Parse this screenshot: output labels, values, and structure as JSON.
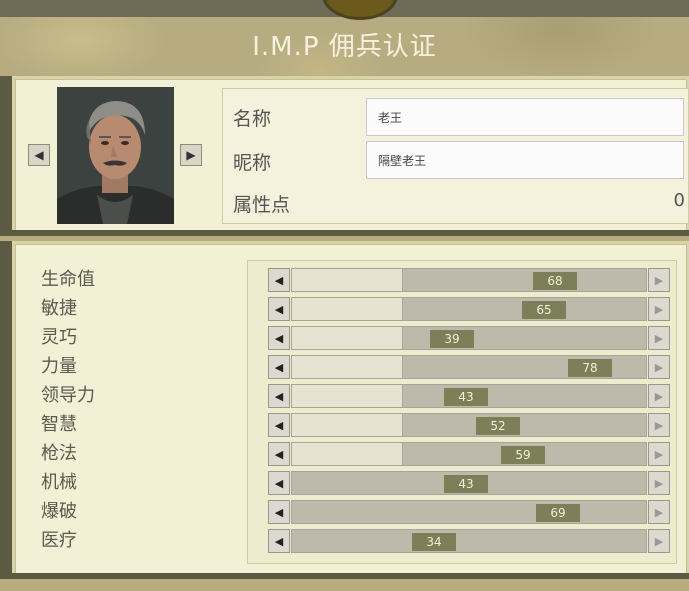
{
  "header": {
    "title": "I.M.P 佣兵认证"
  },
  "profile": {
    "name_label": "名称",
    "name_value": "老王",
    "nickname_label": "昵称",
    "nickname_value": "隔壁老王",
    "attr_points_label": "属性点",
    "attr_points_value": "0",
    "prev_arrow": "◀",
    "next_arrow": "▶"
  },
  "stats": [
    {
      "label": "生命值",
      "value": "68",
      "fraction": 0.68,
      "base_fraction": 0.31
    },
    {
      "label": "敏捷",
      "value": "65",
      "fraction": 0.65,
      "base_fraction": 0.31
    },
    {
      "label": "灵巧",
      "value": "39",
      "fraction": 0.39,
      "base_fraction": 0.31
    },
    {
      "label": "力量",
      "value": "78",
      "fraction": 0.78,
      "base_fraction": 0.31
    },
    {
      "label": "领导力",
      "value": "43",
      "fraction": 0.43,
      "base_fraction": 0.31
    },
    {
      "label": "智慧",
      "value": "52",
      "fraction": 0.52,
      "base_fraction": 0.31
    },
    {
      "label": "枪法",
      "value": "59",
      "fraction": 0.59,
      "base_fraction": 0.31
    },
    {
      "label": "机械",
      "value": "43",
      "fraction": 0.43,
      "base_fraction": 0.0
    },
    {
      "label": "爆破",
      "value": "69",
      "fraction": 0.69,
      "base_fraction": 0.0
    },
    {
      "label": "医疗",
      "value": "34",
      "fraction": 0.34,
      "base_fraction": 0.0
    }
  ],
  "controls": {
    "left_arrow": "◀",
    "right_arrow": "▶"
  }
}
